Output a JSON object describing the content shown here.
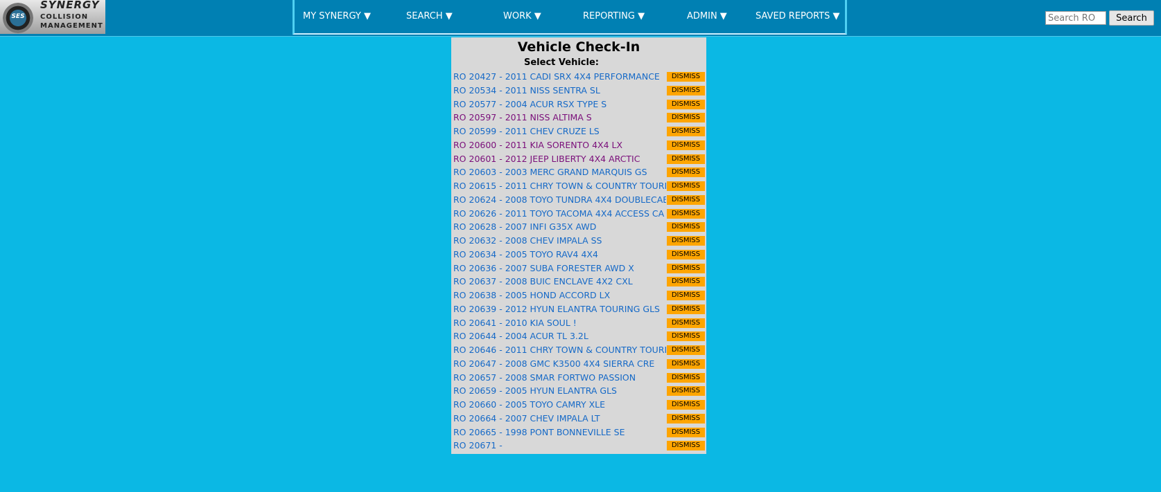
{
  "logo": {
    "badge": "SES",
    "line1": "SYNERGY",
    "line2": "COLLISION",
    "line3": "MANAGEMENT"
  },
  "nav": {
    "items": [
      {
        "label": "MY SYNERGY ▼"
      },
      {
        "label": "SEARCH ▼"
      },
      {
        "label": "WORK ▼"
      },
      {
        "label": "REPORTING ▼"
      },
      {
        "label": "ADMIN ▼"
      },
      {
        "label": "SAVED REPORTS ▼"
      }
    ]
  },
  "search": {
    "placeholder": "Search RO",
    "button_label": "Search"
  },
  "panel": {
    "title": "Vehicle Check-In",
    "subtitle": "Select Vehicle:",
    "dismiss_label": "DISMISS",
    "vehicles": [
      {
        "label": "RO 20427 - 2011 CADI SRX 4X4 PERFORMANCE",
        "visited": false
      },
      {
        "label": "RO 20534 - 2011 NISS SENTRA SL",
        "visited": false
      },
      {
        "label": "RO 20577 - 2004 ACUR RSX TYPE S",
        "visited": false
      },
      {
        "label": "RO 20597 - 2011 NISS ALTIMA S",
        "visited": true
      },
      {
        "label": "RO 20599 - 2011 CHEV CRUZE LS",
        "visited": false
      },
      {
        "label": "RO 20600 - 2011 KIA SORENTO 4X4 LX",
        "visited": true
      },
      {
        "label": "RO 20601 - 2012 JEEP LIBERTY 4X4 ARCTIC",
        "visited": true
      },
      {
        "label": "RO 20603 - 2003 MERC GRAND MARQUIS GS",
        "visited": false
      },
      {
        "label": "RO 20615 - 2011 CHRY TOWN & COUNTRY TOURI",
        "visited": false
      },
      {
        "label": "RO 20624 - 2008 TOYO TUNDRA 4X4 DOUBLECAB",
        "visited": false
      },
      {
        "label": "RO 20626 - 2011 TOYO TACOMA 4X4 ACCESS CA",
        "visited": false
      },
      {
        "label": "RO 20628 - 2007 INFI G35X AWD",
        "visited": false
      },
      {
        "label": "RO 20632 - 2008 CHEV IMPALA SS",
        "visited": false
      },
      {
        "label": "RO 20634 - 2005 TOYO RAV4 4X4",
        "visited": false
      },
      {
        "label": "RO 20636 - 2007 SUBA FORESTER AWD X",
        "visited": false
      },
      {
        "label": "RO 20637 - 2008 BUIC ENCLAVE 4X2 CXL",
        "visited": false
      },
      {
        "label": "RO 20638 - 2005 HOND ACCORD LX",
        "visited": false
      },
      {
        "label": "RO 20639 - 2012 HYUN ELANTRA TOURING GLS",
        "visited": false
      },
      {
        "label": "RO 20641 - 2010 KIA SOUL !",
        "visited": false
      },
      {
        "label": "RO 20644 - 2004 ACUR TL 3.2L",
        "visited": false
      },
      {
        "label": "RO 20646 - 2011 CHRY TOWN & COUNTRY TOURI",
        "visited": false
      },
      {
        "label": "RO 20647 - 2008 GMC K3500 4X4 SIERRA CRE",
        "visited": false
      },
      {
        "label": "RO 20657 - 2008 SMAR FORTWO PASSION",
        "visited": false
      },
      {
        "label": "RO 20659 - 2005 HYUN ELANTRA GLS",
        "visited": false
      },
      {
        "label": "RO 20660 - 2005 TOYO CAMRY XLE",
        "visited": false
      },
      {
        "label": "RO 20664 - 2007 CHEV IMPALA LT",
        "visited": false
      },
      {
        "label": "RO 20665 - 1998 PONT BONNEVILLE SE",
        "visited": false
      },
      {
        "label": "RO 20671 -",
        "visited": false
      }
    ]
  },
  "colors": {
    "page_bg": "#0bb8e4",
    "header_bg": "#0080b3",
    "link": "#1569c7",
    "visited_link": "#7a0e7a",
    "dismiss_bg": "#ffa500",
    "panel_bg": "#d8d8d8"
  }
}
